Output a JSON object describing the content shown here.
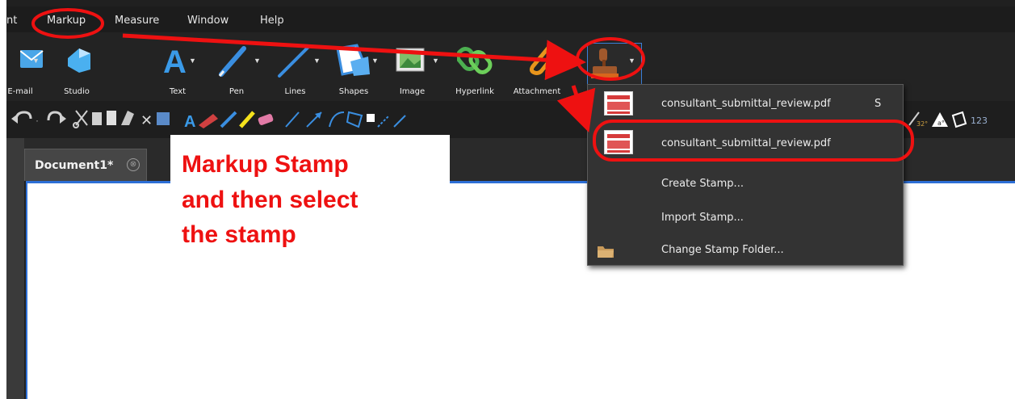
{
  "menubar": {
    "items": [
      {
        "label": "nt"
      },
      {
        "label": "Markup"
      },
      {
        "label": "Measure"
      },
      {
        "label": "Window"
      },
      {
        "label": "Help"
      }
    ]
  },
  "ribbon": {
    "tools": [
      {
        "label": "E-mail",
        "icon": "envelope-icon"
      },
      {
        "label": "Studio",
        "icon": "studio-icon"
      },
      {
        "label": "Text",
        "icon": "text-A-icon"
      },
      {
        "label": "Pen",
        "icon": "pen-icon"
      },
      {
        "label": "Lines",
        "icon": "line-icon"
      },
      {
        "label": "Shapes",
        "icon": "shapes-icon"
      },
      {
        "label": "Image",
        "icon": "image-icon"
      },
      {
        "label": "Hyperlink",
        "icon": "hyperlink-icon"
      },
      {
        "label": "Attachment",
        "icon": "paperclip-icon"
      }
    ],
    "stamp_icon": "stamp-icon"
  },
  "toolbar2": {
    "right_number": "123"
  },
  "tab": {
    "label": "Document1*",
    "close": "⊗"
  },
  "annotation": {
    "lines": [
      "Markup Stamp",
      "and then select",
      "the stamp"
    ]
  },
  "stamp_menu": {
    "items": [
      {
        "label": "consultant_submittal_review.pdf",
        "shortcut": "S",
        "icon": "pdf-stamp-icon"
      },
      {
        "label": "consultant_submittal_review.pdf",
        "shortcut": "",
        "icon": "pdf-stamp-icon"
      },
      {
        "label": "Create Stamp...",
        "icon": ""
      },
      {
        "label": "Import Stamp...",
        "icon": ""
      },
      {
        "label": "Change Stamp Folder...",
        "icon": "folder-icon"
      }
    ]
  },
  "colors": {
    "accent_red": "#ee1111",
    "selection_blue": "#3b7fd9",
    "background_dark": "#202020"
  }
}
